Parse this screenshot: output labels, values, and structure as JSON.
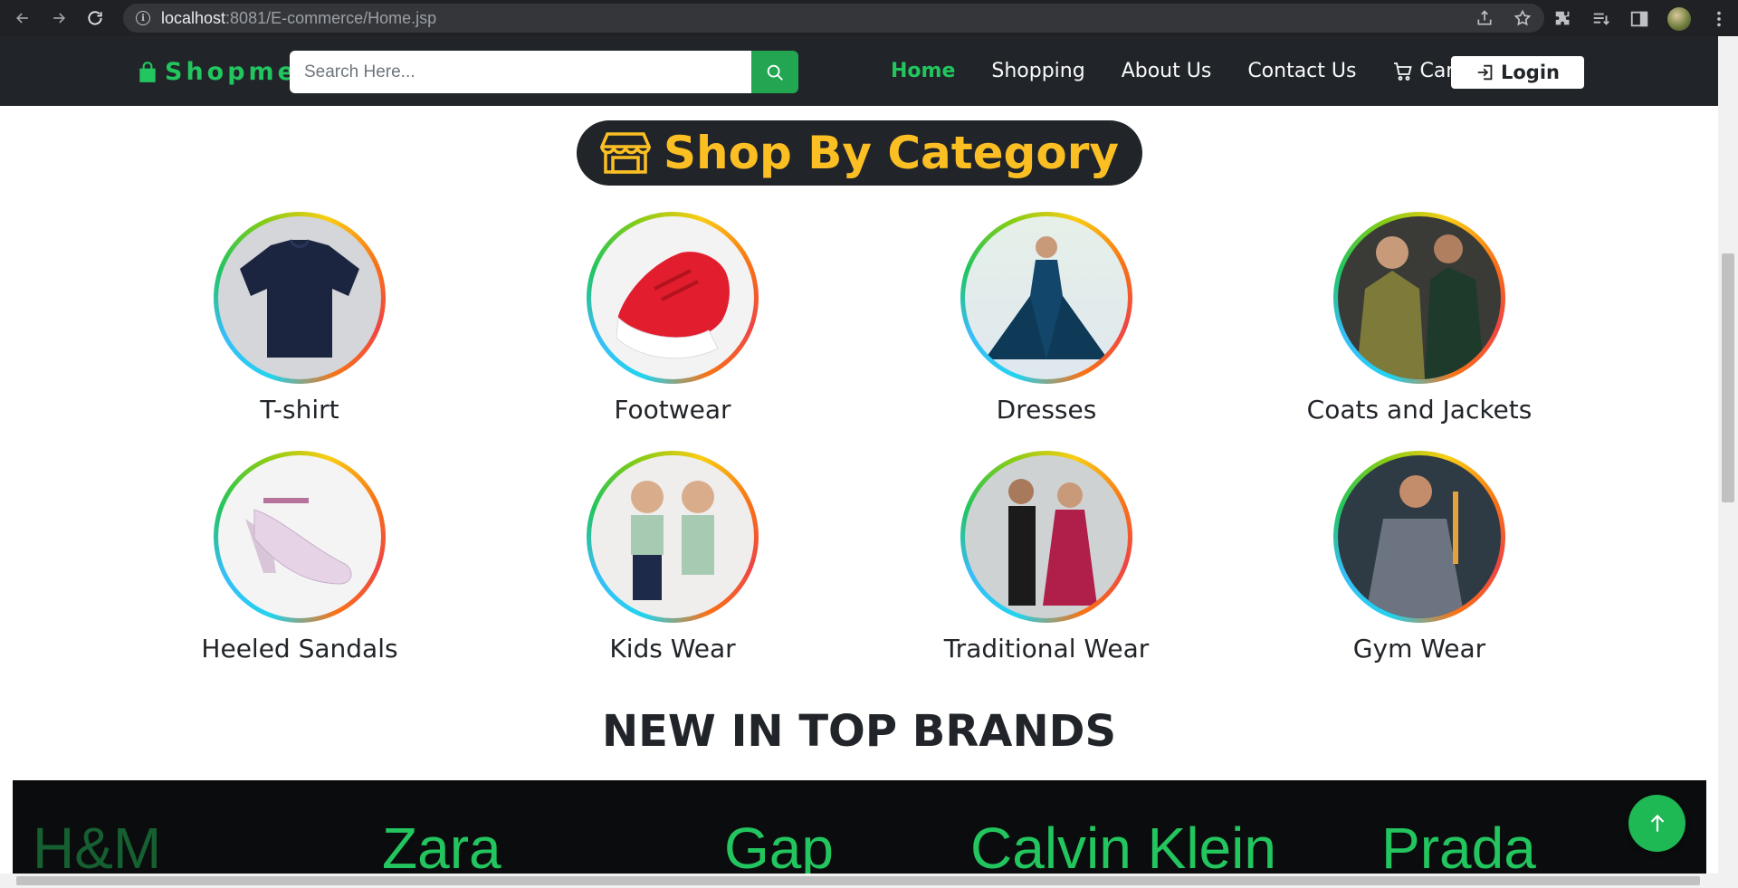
{
  "browser": {
    "url_host": "localhost",
    "url_path": ":8081/E-commerce/Home.jsp"
  },
  "navbar": {
    "brand": "Shopme",
    "search_placeholder": "Search Here...",
    "links": {
      "home": "Home",
      "shopping": "Shopping",
      "about": "About Us",
      "contact": "Contact Us",
      "cart": "Cart"
    },
    "login": "Login",
    "accent_color": "#22c55e"
  },
  "category_section": {
    "heading": "Shop By Category",
    "heading_color": "#fbbf24",
    "categories": [
      {
        "label": "T-shirt"
      },
      {
        "label": "Footwear"
      },
      {
        "label": "Dresses"
      },
      {
        "label": "Coats and Jackets"
      },
      {
        "label": "Heeled Sandals"
      },
      {
        "label": "Kids Wear"
      },
      {
        "label": "Traditional Wear"
      },
      {
        "label": "Gym Wear"
      }
    ]
  },
  "brands_section": {
    "title": "NEW IN TOP BRANDS",
    "brands": [
      "H&M",
      "Zara",
      "Gap",
      "Calvin Klein",
      "Prada"
    ]
  }
}
